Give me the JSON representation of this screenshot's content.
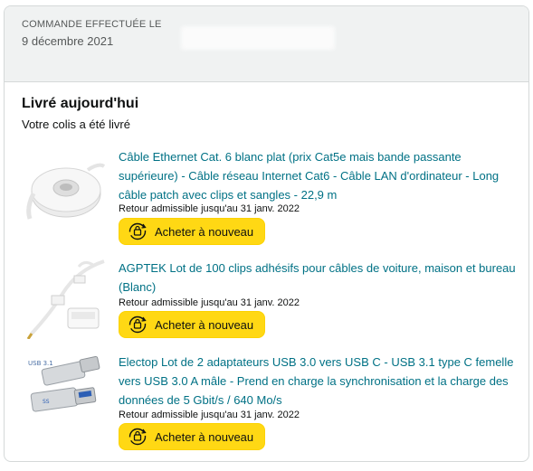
{
  "header": {
    "order_label": "COMMANDE EFFECTUÉE LE",
    "order_date": "9 décembre 2021"
  },
  "delivery": {
    "title": "Livré aujourd'hui",
    "subtitle": "Votre colis a été livré"
  },
  "items": [
    {
      "title": "Câble Ethernet Cat. 6 blanc plat (prix Cat5e mais bande passante supérieure) - Câble réseau Internet Cat6 - Câble LAN d'ordinateur - Long câble patch avec clips et sangles - 22,9 m",
      "return_text": "Retour admissible jusqu'au 31 janv. 2022",
      "button_label": "Acheter à nouveau",
      "thumbnail": "white-flat-cable-reel"
    },
    {
      "title": "AGPTEK Lot de 100 clips adhésifs pour câbles de voiture, maison et bureau (Blanc)",
      "return_text": "Retour admissible jusqu'au 31 janv. 2022",
      "button_label": "Acheter à nouveau",
      "thumbnail": "adhesive-cable-clips"
    },
    {
      "title": "Electop Lot de 2 adaptateurs USB 3.0 vers USB C - USB 3.1 type C femelle vers USB 3.0 A mâle - Prend en charge la synchronisation et la charge des données de 5 Gbit/s / 640 Mo/s",
      "return_text": "Retour admissible jusqu'au 31 janv. 2022",
      "button_label": "Acheter à nouveau",
      "thumbnail": "usb-c-adapters"
    }
  ],
  "colors": {
    "link": "#007185",
    "button": "#ffd814",
    "header_bg": "#f0f2f2"
  }
}
